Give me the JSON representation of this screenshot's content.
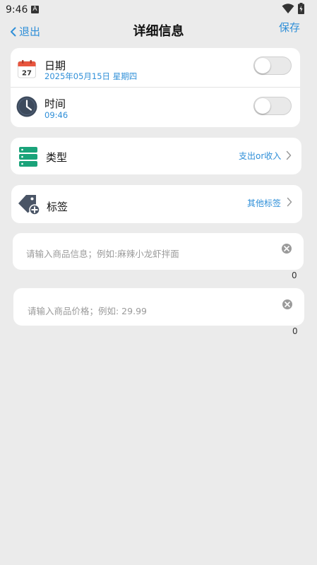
{
  "status_bar": {
    "time": "9:46",
    "notification_badge": "A"
  },
  "nav": {
    "back_label": "退出",
    "title": "详细信息",
    "save_label": "保存"
  },
  "datetime_card": {
    "date": {
      "title": "日期",
      "value": "2025年05月15日 星期四",
      "calendar_day": "27",
      "toggle_on": false
    },
    "time": {
      "title": "时间",
      "value": "09:46",
      "toggle_on": false
    }
  },
  "type_row": {
    "title": "类型",
    "value": "支出or收入"
  },
  "tag_row": {
    "title": "标签",
    "value": "其他标签"
  },
  "product_info": {
    "placeholder": "请输入商品信息；例如:麻辣小龙虾拌面",
    "counter": "0"
  },
  "product_price": {
    "placeholder": "请输入商品价格；例如: 29.99",
    "counter": "0"
  },
  "colors": {
    "accent": "#2f8fd8",
    "background": "#ebebeb",
    "card": "#ffffff",
    "type_icon": "#1aa37a",
    "tag_icon": "#4a5566",
    "clock_icon": "#3d4a5c",
    "calendar_red": "#e8553e"
  },
  "icons": {
    "back": "chevron-left-icon",
    "date": "calendar-icon",
    "time": "clock-icon",
    "type": "list-stack-icon",
    "tag": "tag-add-icon",
    "clear": "close-circle-icon",
    "row_arrow": "chevron-right-icon"
  }
}
